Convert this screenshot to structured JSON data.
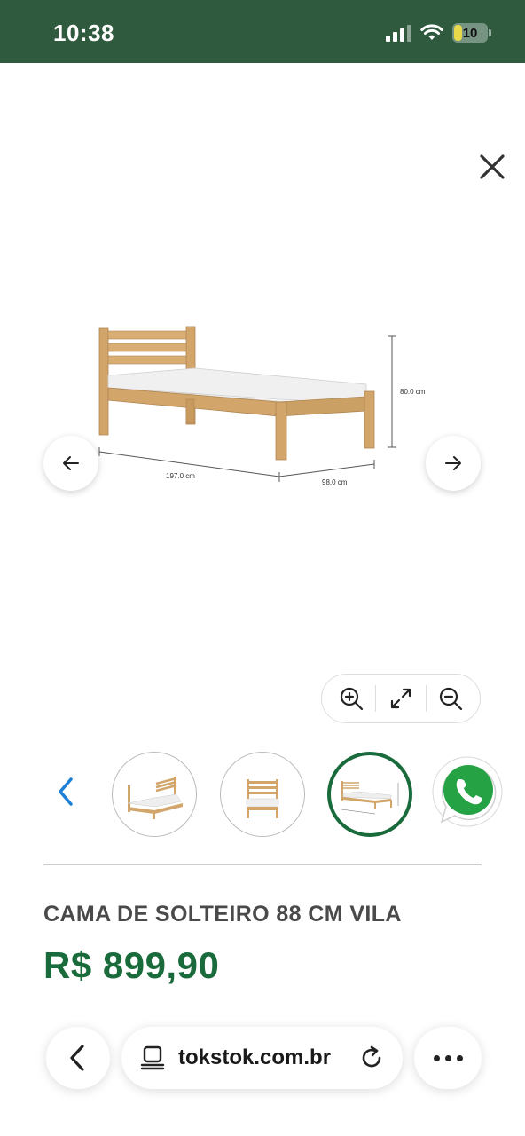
{
  "status_bar": {
    "time": "10:38",
    "battery_level": "10",
    "icons": [
      "signal-icon",
      "wifi-icon",
      "battery-icon"
    ]
  },
  "gallery": {
    "close_icon": "close-icon",
    "prev_icon": "arrow-left-icon",
    "next_icon": "arrow-right-icon",
    "dimensions": {
      "height": "80.0 cm",
      "length": "197.0 cm",
      "width": "98.0 cm"
    },
    "zoom_controls": [
      "zoom-in-icon",
      "fullscreen-icon",
      "zoom-out-icon"
    ],
    "thumbnails": [
      {
        "name": "bed-angle-view",
        "active": false
      },
      {
        "name": "bed-front-view",
        "active": false
      },
      {
        "name": "bed-dimensions-view",
        "active": true
      }
    ]
  },
  "product": {
    "title": "CAMA DE SOLTEIRO 88 CM VILA",
    "price": "R$ 899,90"
  },
  "browser": {
    "url": "tokstok.com.br"
  },
  "colors": {
    "status_bar": "#2f5a3e",
    "price": "#1a6b3c",
    "accent_blue": "#1e7fd6",
    "whatsapp": "#25a244"
  }
}
